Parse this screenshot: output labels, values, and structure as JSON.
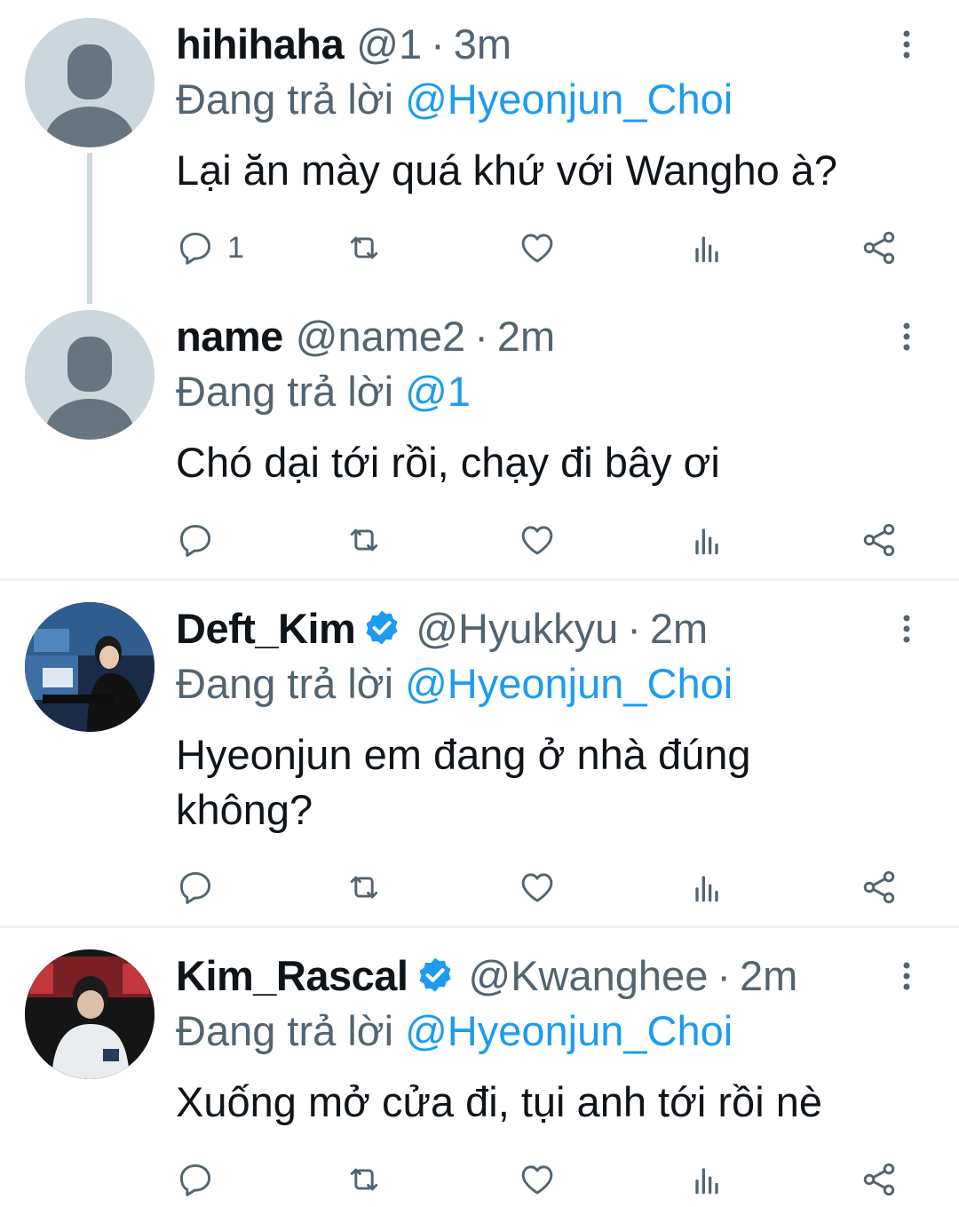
{
  "reply_prefix": "Đang trả lời",
  "tweets": [
    {
      "name": "hihihaha",
      "handle": "@1",
      "time": "3m",
      "reply_to": "@Hyeonjun_Choi",
      "text": "Lại ăn mày quá khứ với Wangho à?",
      "reply_count": "1",
      "verified": false
    },
    {
      "name": "name",
      "handle": "@name2",
      "time": "2m",
      "reply_to": "@1",
      "text": "Chó dại tới rồi, chạy đi bây ơi",
      "reply_count": "",
      "verified": false
    },
    {
      "name": "Deft_Kim",
      "handle": "@Hyukkyu",
      "time": "2m",
      "reply_to": "@Hyeonjun_Choi",
      "text": "Hyeonjun em đang ở nhà đúng không?",
      "reply_count": "",
      "verified": true
    },
    {
      "name": "Kim_Rascal",
      "handle": "@Kwanghee",
      "time": "2m",
      "reply_to": "@Hyeonjun_Choi",
      "text": "Xuống mở cửa đi, tụi anh tới rồi nè",
      "reply_count": "",
      "verified": true
    }
  ],
  "colors": {
    "accent": "#1d9bf0",
    "muted": "#536471",
    "text": "#0f1419",
    "divider": "#eff3f4"
  },
  "icons": [
    "reply-icon",
    "retweet-icon",
    "like-icon",
    "analytics-icon",
    "share-icon",
    "more-icon",
    "verified-badge-icon"
  ]
}
